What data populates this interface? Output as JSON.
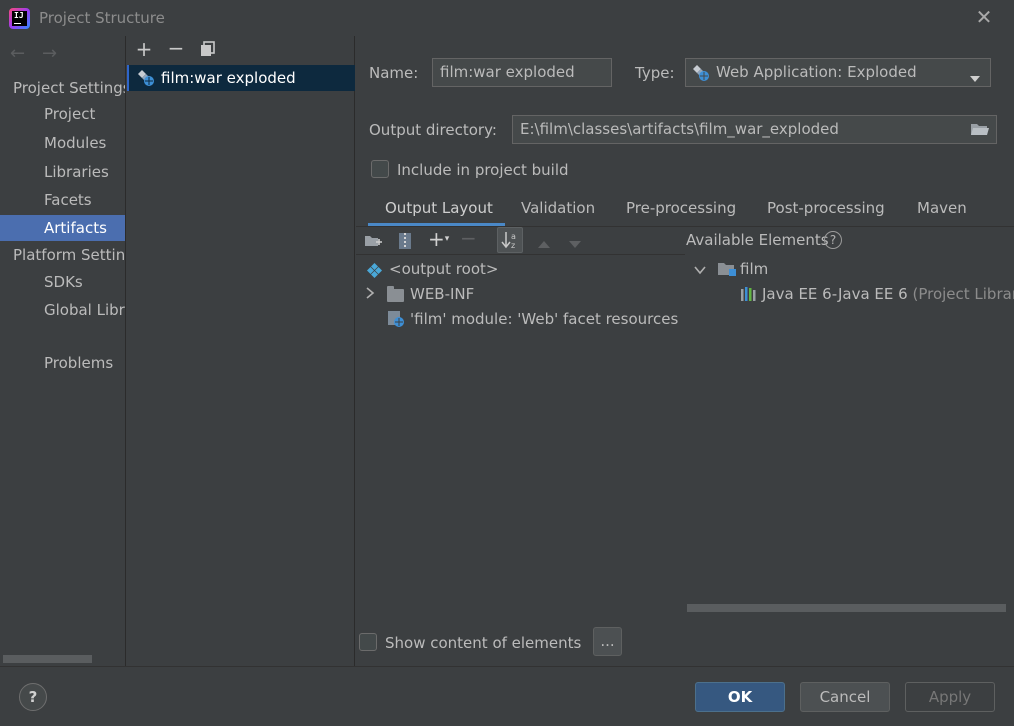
{
  "window": {
    "title": "Project Structure"
  },
  "nav": {
    "project_settings_header": "Project Settings",
    "project_settings_items": [
      {
        "label": "Project"
      },
      {
        "label": "Modules"
      },
      {
        "label": "Libraries"
      },
      {
        "label": "Facets"
      },
      {
        "label": "Artifacts"
      }
    ],
    "platform_settings_header": "Platform Settings",
    "platform_settings_items": [
      {
        "label": "SDKs"
      },
      {
        "label": "Global Libraries"
      }
    ],
    "problems_label": "Problems",
    "selected": "Artifacts"
  },
  "artifacts_list": {
    "items": [
      {
        "label": "film:war exploded",
        "icon": "web-artifact-icon"
      }
    ]
  },
  "form": {
    "name_label": "Name:",
    "name_value": "film:war exploded",
    "type_label": "Type:",
    "type_value": "Web Application: Exploded",
    "output_dir_label": "Output directory:",
    "output_dir_value": "E:\\film\\classes\\artifacts\\film_war_exploded",
    "include_build_label": "Include in project build",
    "include_build_checked": false
  },
  "tabs": [
    {
      "label": "Output Layout",
      "active": true
    },
    {
      "label": "Validation"
    },
    {
      "label": "Pre-processing"
    },
    {
      "label": "Post-processing"
    },
    {
      "label": "Maven"
    }
  ],
  "output_layout": {
    "tree": [
      {
        "label": "<output root>",
        "icon": "output-root-icon"
      },
      {
        "label": "WEB-INF",
        "icon": "folder-icon"
      },
      {
        "label": "'film' module: 'Web' facet resources",
        "icon": "web-facet-icon"
      }
    ]
  },
  "available": {
    "header": "Available Elements",
    "module": "film",
    "library_name": "Java EE 6-Java EE 6",
    "library_suffix": "(Project Library)"
  },
  "bottom": {
    "show_content_label": "Show content of elements",
    "show_content_checked": false,
    "ellipsis_label": "...",
    "help_label": "?",
    "ok_label": "OK",
    "cancel_label": "Cancel",
    "apply_label": "Apply"
  },
  "colors": {
    "accent": "#4b6eaf",
    "selection": "#0d293e",
    "primary_button": "#365880",
    "background": "#3c3f41"
  }
}
